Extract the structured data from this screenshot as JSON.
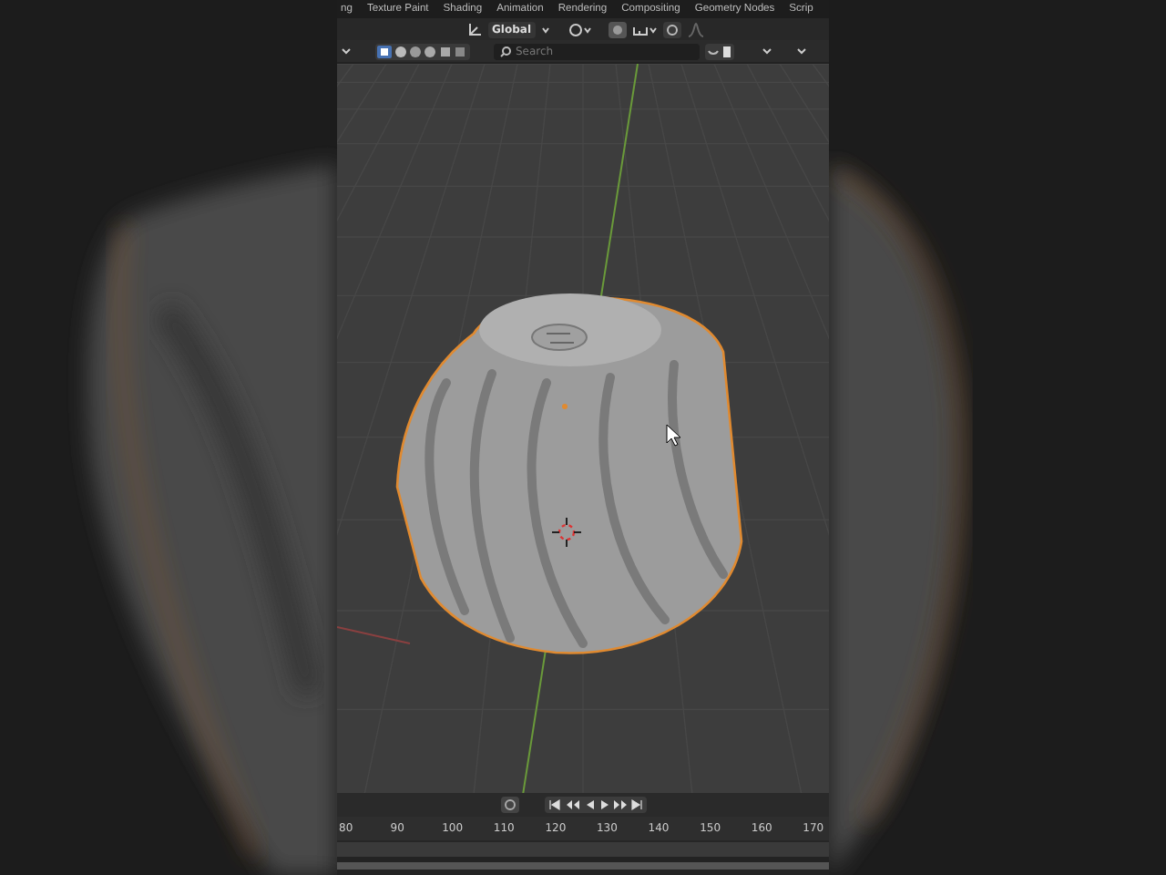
{
  "workspace_tabs": [
    {
      "label": "ng",
      "selected": false
    },
    {
      "label": "Texture Paint",
      "selected": false
    },
    {
      "label": "Shading",
      "selected": false
    },
    {
      "label": "Animation",
      "selected": false
    },
    {
      "label": "Rendering",
      "selected": false
    },
    {
      "label": "Compositing",
      "selected": false
    },
    {
      "label": "Geometry Nodes",
      "selected": false
    },
    {
      "label": "Scrip",
      "selected": false
    }
  ],
  "header": {
    "orientation": "Global"
  },
  "search": {
    "placeholder": "Search"
  },
  "timeline": {
    "frames": [
      "80",
      "90",
      "100",
      "110",
      "120",
      "130",
      "140",
      "150",
      "160",
      "170"
    ]
  }
}
